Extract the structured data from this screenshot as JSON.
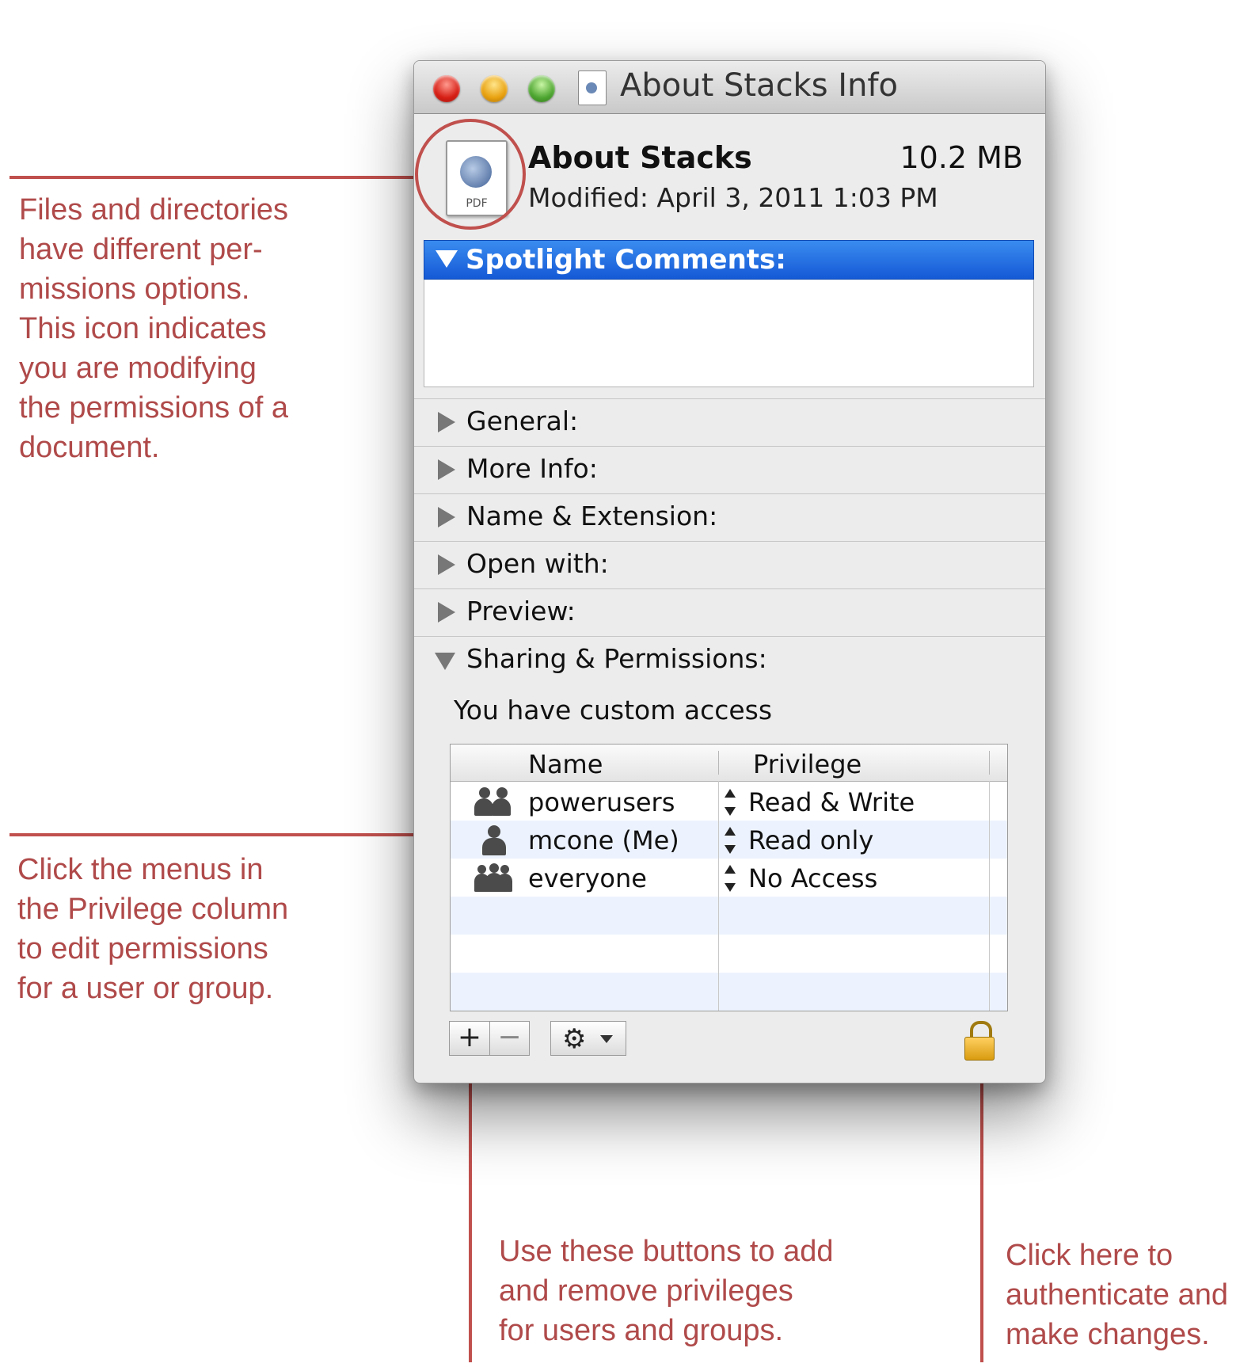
{
  "window": {
    "title": "About Stacks Info",
    "file_name": "About Stacks",
    "file_size": "10.2 MB",
    "modified": "Modified: April 3, 2011 1:03 PM",
    "doc_icon_label": "PDF"
  },
  "spotlight": {
    "label": "Spotlight Comments:"
  },
  "sections": [
    {
      "label": "General:",
      "expanded": false
    },
    {
      "label": "More Info:",
      "expanded": false
    },
    {
      "label": "Name & Extension:",
      "expanded": false
    },
    {
      "label": "Open with:",
      "expanded": false
    },
    {
      "label": "Preview:",
      "expanded": false
    },
    {
      "label": "Sharing & Permissions:",
      "expanded": true
    }
  ],
  "sharing": {
    "access_text": "You have custom access",
    "columns": {
      "name": "Name",
      "privilege": "Privilege"
    },
    "rows": [
      {
        "name": "powerusers",
        "privilege": "Read & Write",
        "icon": "group-icon"
      },
      {
        "name": "mcone (Me)",
        "privilege": "Read only",
        "icon": "user-icon"
      },
      {
        "name": "everyone",
        "privilege": "No Access",
        "icon": "everyone-icon"
      }
    ]
  },
  "toolbar": {
    "add_label": "+",
    "remove_label": "−",
    "action_icon": "gear-icon",
    "lock_icon": "lock-icon"
  },
  "annotations": {
    "icon_note": "Files and directories\nhave different per-\nmissions options.\nThis icon indicates\nyou are modifying\nthe permissions of a\ndocument.",
    "privilege_note": "Click the menus in\nthe Privilege column\nto edit permissions\nfor a user or group.",
    "buttons_note": "Use these buttons to add\nand remove privileges\nfor users and groups.",
    "lock_note": "Click here to\nauthenticate and\nmake changes."
  },
  "colors": {
    "annotation": "#b04a4a",
    "selection": "#1f6fe5",
    "row_alt": "#edf3fe"
  }
}
